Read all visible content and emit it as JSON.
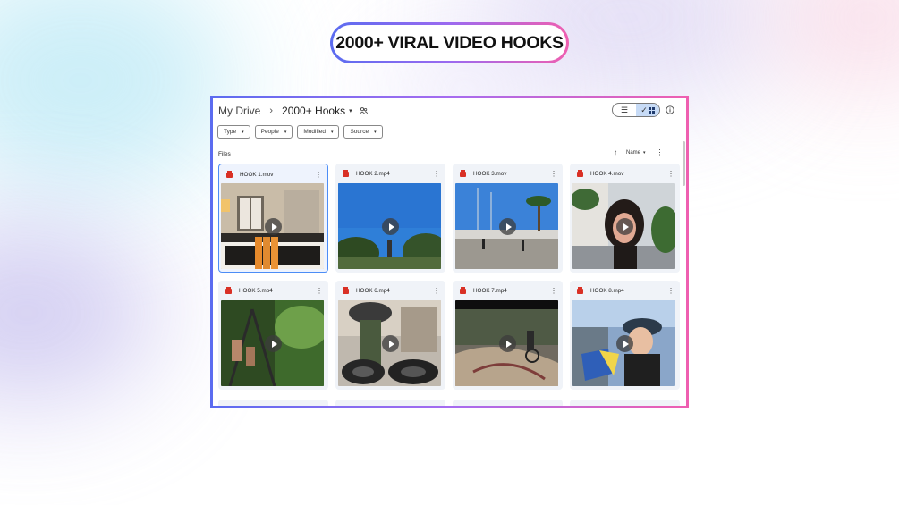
{
  "hero": {
    "title": "2000+ VIRAL VIDEO HOOKS"
  },
  "breadcrumb": {
    "root": "My Drive",
    "separator": "›",
    "current": "2000+ Hooks"
  },
  "filters": [
    {
      "label": "Type"
    },
    {
      "label": "People"
    },
    {
      "label": "Modified"
    },
    {
      "label": "Source"
    }
  ],
  "files_section": {
    "label": "Files"
  },
  "sort": {
    "field": "Name"
  },
  "icons": {
    "chevron": "▾",
    "arrow_up": "↑",
    "more": "⋮",
    "list_view": "☰",
    "grid_check": "✓"
  },
  "colors": {
    "accent_start": "#5b6cf0",
    "accent_end": "#ef5fb0",
    "selected_border": "#4c8df6",
    "video_icon": "#d93025"
  },
  "files": [
    {
      "name": "HOOK 1.mov",
      "selected": true
    },
    {
      "name": "HOOK 2.mp4",
      "selected": false
    },
    {
      "name": "HOOK 3.mov",
      "selected": false
    },
    {
      "name": "HOOK 4.mov",
      "selected": false
    },
    {
      "name": "HOOK 5.mp4",
      "selected": false
    },
    {
      "name": "HOOK 6.mp4",
      "selected": false
    },
    {
      "name": "HOOK 7.mp4",
      "selected": false
    },
    {
      "name": "HOOK 8.mp4",
      "selected": false
    }
  ]
}
